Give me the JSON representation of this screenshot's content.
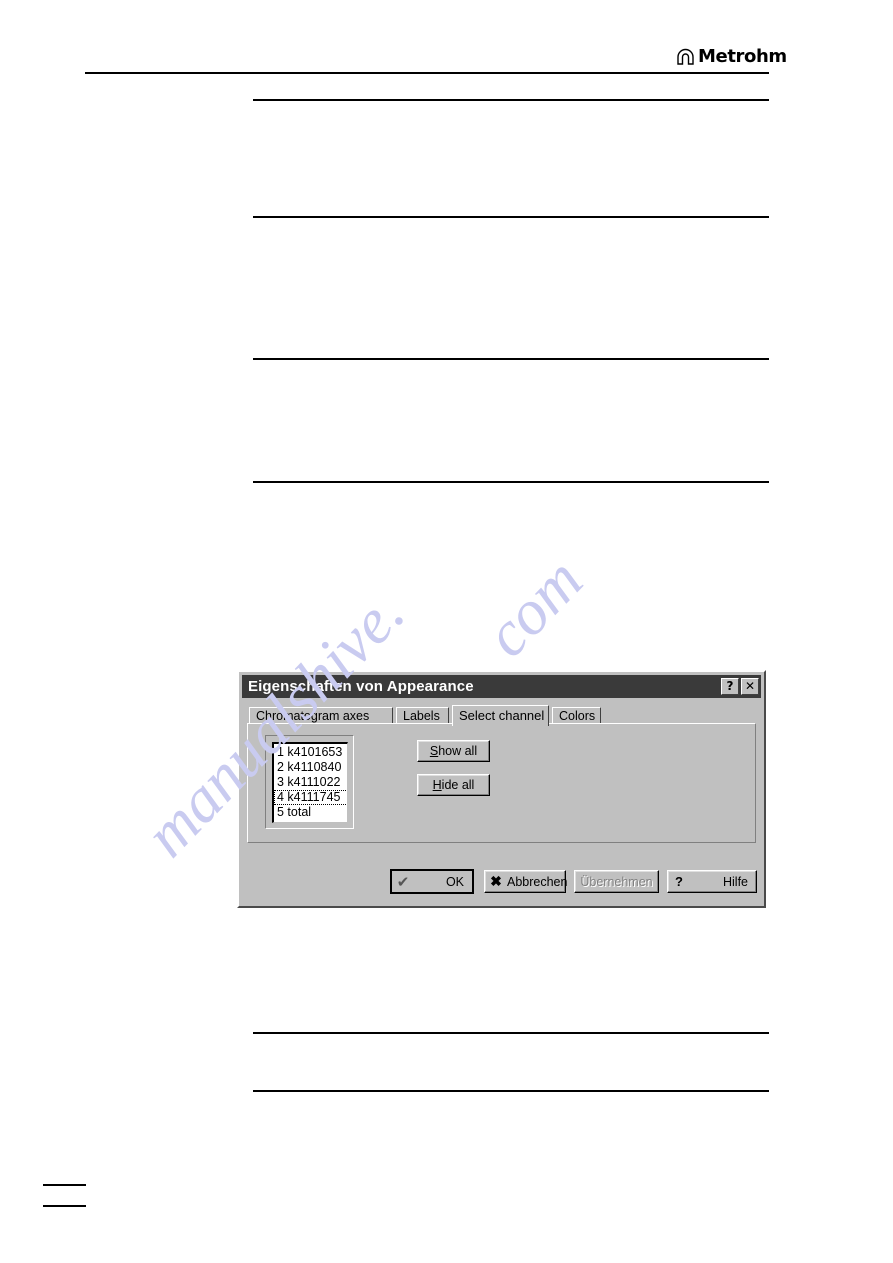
{
  "document": {
    "logo": {
      "word": "Metrohm",
      "mark": "omega-arch-icon"
    }
  },
  "dialog": {
    "title": "Eigenschaften von Appearance",
    "title_buttons": [
      {
        "name": "help-button",
        "glyph": "?"
      },
      {
        "name": "close-button",
        "glyph": "✕"
      }
    ],
    "tabs": [
      {
        "label": "Chromatogram axes",
        "active": false
      },
      {
        "label": "Labels",
        "active": false
      },
      {
        "label": "Select channel",
        "active": true
      },
      {
        "label": "Colors",
        "active": false
      }
    ],
    "channel_list": {
      "items": [
        {
          "label": "1 k4101653",
          "focused": false
        },
        {
          "label": "2 k4110840",
          "focused": false
        },
        {
          "label": "3 k4111022",
          "focused": false
        },
        {
          "label": "4 k4111745",
          "focused": true
        },
        {
          "label": "5 total",
          "focused": false
        }
      ]
    },
    "panel_buttons": {
      "show_all": {
        "accel": "S",
        "rest": "how all"
      },
      "hide_all": {
        "accel": "H",
        "rest": "ide all"
      }
    },
    "footer_buttons": {
      "ok": {
        "label": "OK",
        "icon": "✔",
        "default": true,
        "disabled": false
      },
      "cancel": {
        "label": "Abbrechen",
        "icon": "✖",
        "default": false,
        "disabled": false
      },
      "apply": {
        "label": "Übernehmen",
        "icon": "",
        "default": false,
        "disabled": true
      },
      "help": {
        "label": "Hilfe",
        "icon": "?",
        "default": false,
        "disabled": false
      }
    }
  },
  "watermark": {
    "line1": "manualshive.",
    "line2": "com"
  },
  "colors": {
    "dialog_face": "#c0c0c0",
    "titlebar": "#3a3a3a",
    "titlebar_text": "#ffffff",
    "list_background": "#ffffff",
    "text": "#000000",
    "disabled_text": "#808080",
    "watermark": "#c9cbf0"
  }
}
